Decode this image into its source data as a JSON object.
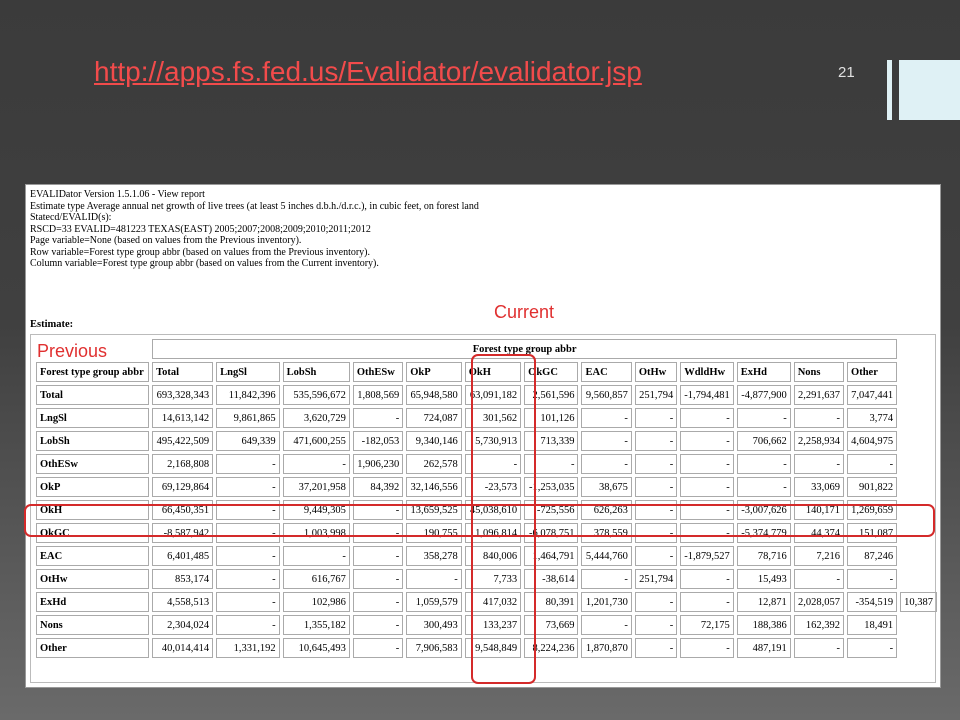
{
  "slide": {
    "link": "http://apps.fs.fed.us/Evalidator/evalidator.jsp",
    "number": "21"
  },
  "annotations": {
    "current": "Current",
    "previous": "Previous"
  },
  "report": {
    "header_lines": [
      "EVALIDator Version 1.5.1.06 - View report",
      "Estimate type Average annual net growth of live trees (at least 5 inches d.b.h./d.r.c.), in cubic feet, on forest land",
      "Statecd/EVALID(s):",
      "RSCD=33 EVALID=481223 TEXAS(EAST) 2005;2007;2008;2009;2010;2011;2012",
      "Page variable=None (based on values from the Previous inventory).",
      "Row variable=Forest type group abbr (based on values from the Previous inventory).",
      "Column variable=Forest type group abbr (based on values from the Current inventory)."
    ],
    "estimate_label": "Estimate:",
    "column_group": "Forest type group abbr",
    "row_header": "Forest type group abbr",
    "columns": [
      "Total",
      "LngSl",
      "LobSh",
      "OthESw",
      "OkP",
      "OkH",
      "OkGC",
      "EAC",
      "OtHw",
      "WdldHw",
      "ExHd",
      "Nons",
      "Other"
    ],
    "rows": [
      {
        "label": "Total",
        "values": [
          "693,328,343",
          "11,842,396",
          "535,596,672",
          "1,808,569",
          "65,948,580",
          "63,091,182",
          "2,561,596",
          "9,560,857",
          "251,794",
          "-1,794,481",
          "-4,877,900",
          "2,291,637",
          "7,047,441"
        ]
      },
      {
        "label": "LngSl",
        "values": [
          "14,613,142",
          "9,861,865",
          "3,620,729",
          "-",
          "724,087",
          "301,562",
          "101,126",
          "-",
          "-",
          "-",
          "-",
          "-",
          "3,774"
        ]
      },
      {
        "label": "LobSh",
        "values": [
          "495,422,509",
          "649,339",
          "471,600,255",
          "-182,053",
          "9,340,146",
          "5,730,913",
          "713,339",
          "-",
          "-",
          "-",
          "706,662",
          "2,258,934",
          "4,604,975"
        ]
      },
      {
        "label": "OthESw",
        "values": [
          "2,168,808",
          "-",
          "-",
          "1,906,230",
          "262,578",
          "-",
          "-",
          "-",
          "-",
          "-",
          "-",
          "-",
          "-"
        ]
      },
      {
        "label": "OkP",
        "values": [
          "69,129,864",
          "-",
          "37,201,958",
          "84,392",
          "32,146,556",
          "-23,573",
          "-1,253,035",
          "38,675",
          "-",
          "-",
          "-",
          "33,069",
          "901,822"
        ]
      },
      {
        "label": "OkH",
        "values": [
          "66,450,351",
          "-",
          "9,449,305",
          "-",
          "13,659,525",
          "45,038,610",
          "-725,556",
          "626,263",
          "-",
          "-",
          "-3,007,626",
          "140,171",
          "1,269,659"
        ]
      },
      {
        "label": "OkGC",
        "values": [
          "-8,587,942",
          "-",
          "1,003,998",
          "-",
          "190,755",
          "1,096,814",
          "-6,078,751",
          "378,559",
          "-",
          "-",
          "-5,374,779",
          "44,374",
          "151,087"
        ]
      },
      {
        "label": "EAC",
        "values": [
          "6,401,485",
          "-",
          "-",
          "-",
          "358,278",
          "840,006",
          "1,464,791",
          "5,444,760",
          "-",
          "-1,879,527",
          "78,716",
          "7,216",
          "87,246"
        ]
      },
      {
        "label": "OtHw",
        "values": [
          "853,174",
          "-",
          "616,767",
          "-",
          "-",
          "7,733",
          "-38,614",
          "-",
          "251,794",
          "-",
          "15,493",
          "-",
          "-"
        ]
      },
      {
        "label": "ExHd",
        "values": [
          "4,558,513",
          "-",
          "102,986",
          "-",
          "1,059,579",
          "417,032",
          "80,391",
          "1,201,730",
          "-",
          "-",
          "12,871",
          "2,028,057",
          "-354,519",
          "10,387"
        ]
      },
      {
        "label": "Nons",
        "values": [
          "2,304,024",
          "-",
          "1,355,182",
          "-",
          "300,493",
          "133,237",
          "73,669",
          "-",
          "-",
          "72,175",
          "188,386",
          "162,392",
          "18,491"
        ]
      },
      {
        "label": "Other",
        "values": [
          "40,014,414",
          "1,331,192",
          "10,645,493",
          "-",
          "7,906,583",
          "9,548,849",
          "8,224,236",
          "1,870,870",
          "-",
          "-",
          "487,191",
          "-",
          "-"
        ]
      }
    ]
  },
  "colors": {
    "annotation": "#d42a2a",
    "link": "#f24b4b",
    "accent_bars": "#dff1f5"
  }
}
